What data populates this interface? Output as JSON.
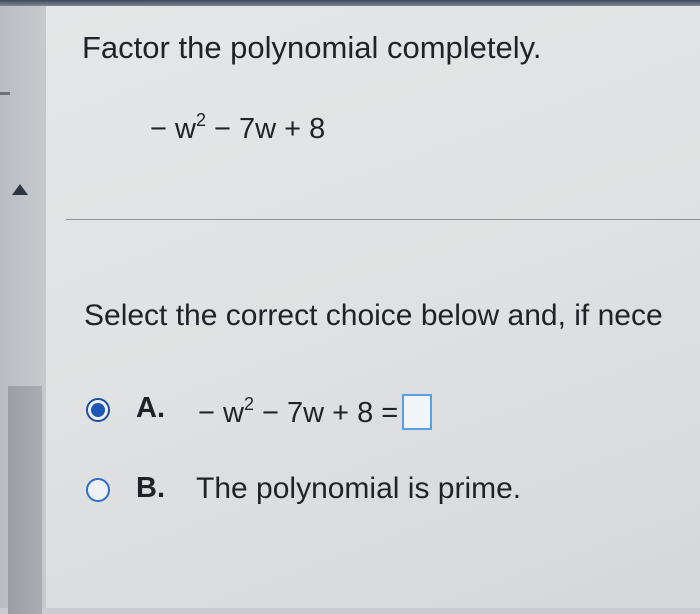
{
  "question": {
    "title": "Factor the polynomial completely.",
    "expression": {
      "lead": "− w",
      "exponent": "2",
      "rest": " − 7w + 8"
    }
  },
  "instruction": "Select the correct choice below and, if nece",
  "choices": [
    {
      "letter": "A.",
      "selected": true,
      "expression": {
        "lead": "− w",
        "exponent": "2",
        "rest": " − 7w + 8 ="
      },
      "answer_value": ""
    },
    {
      "letter": "B.",
      "selected": false,
      "text": "The polynomial is prime."
    }
  ],
  "colors": {
    "radio_selected": "#1d56b3",
    "radio_border": "#2b6ec9",
    "answer_box_border": "#5aa0e6",
    "text": "#1f2328"
  },
  "icons": {
    "collapse": "triangle-up-icon"
  }
}
